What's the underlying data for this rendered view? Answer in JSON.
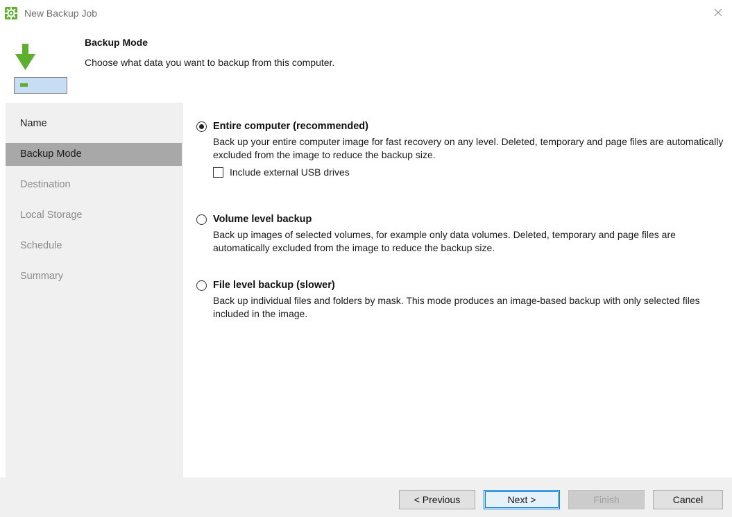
{
  "window": {
    "title": "New Backup Job",
    "icon": "gear-icon",
    "close_icon": "close-icon"
  },
  "header": {
    "title": "Backup Mode",
    "subtitle": "Choose what data you want to backup from this computer.",
    "icon": "download-to-drive-icon"
  },
  "sidebar": {
    "items": [
      {
        "label": "Name",
        "state": "done"
      },
      {
        "label": "Backup Mode",
        "state": "active"
      },
      {
        "label": "Destination",
        "state": "pending"
      },
      {
        "label": "Local Storage",
        "state": "pending"
      },
      {
        "label": "Schedule",
        "state": "pending"
      },
      {
        "label": "Summary",
        "state": "pending"
      }
    ]
  },
  "options": {
    "entire": {
      "label": "Entire computer (recommended)",
      "description": "Back up your entire computer image for fast recovery on any level. Deleted, temporary and page files are automatically excluded from the image to reduce the backup size.",
      "selected": true,
      "usb_checkbox_label": "Include external USB drives",
      "usb_checked": false
    },
    "volume": {
      "label": "Volume level backup",
      "description": "Back up images of selected volumes, for example only data volumes. Deleted, temporary and page files are automatically excluded from the image to reduce the backup size.",
      "selected": false
    },
    "file": {
      "label": "File level backup (slower)",
      "description": "Back up individual files and folders by mask. This mode produces an image-based backup with only selected files included in the image.",
      "selected": false
    }
  },
  "buttons": {
    "previous": "< Previous",
    "next": "Next >",
    "finish": "Finish",
    "cancel": "Cancel"
  },
  "colors": {
    "accent_green": "#5cb02e",
    "focus_blue": "#0078d7",
    "sidebar_bg": "#f0f0f0",
    "sidebar_active": "#a8a8a8"
  }
}
